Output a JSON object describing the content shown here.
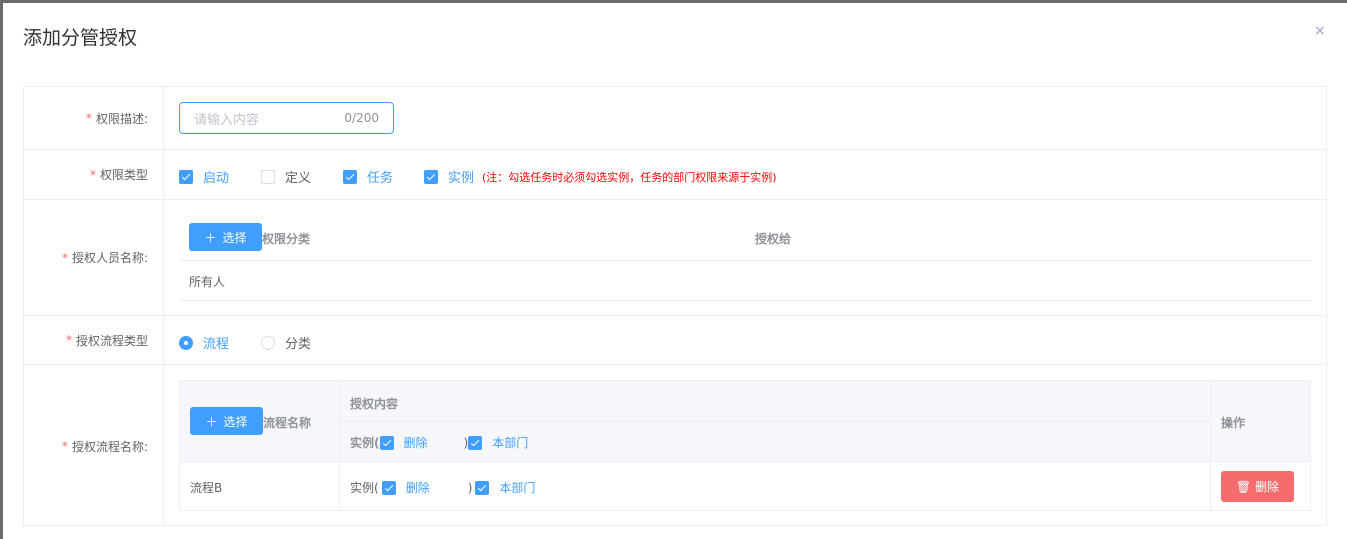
{
  "dialog": {
    "title": "添加分管授权",
    "close": "×"
  },
  "fields": {
    "desc": {
      "label": "权限描述:",
      "placeholder": "请输入内容",
      "counter": "0/200"
    },
    "type": {
      "label": "权限类型",
      "options": [
        {
          "label": "启动",
          "checked": true
        },
        {
          "label": "定义",
          "checked": false
        },
        {
          "label": "任务",
          "checked": true
        },
        {
          "label": "实例",
          "checked": true
        }
      ],
      "note": "(注：勾选任务时必须勾选实例，任务的部门权限来源于实例)"
    },
    "persons": {
      "label": "授权人员名称:",
      "select": "选择",
      "columns": [
        "权限分类",
        "授权给"
      ],
      "rows": [
        {
          "category": "所有人",
          "to": ""
        }
      ]
    },
    "flow_type": {
      "label": "授权流程类型",
      "options": [
        {
          "label": "流程",
          "selected": true
        },
        {
          "label": "分类",
          "selected": false
        }
      ]
    },
    "flows": {
      "label": "授权流程名称:",
      "select": "选择",
      "col_name": "流程名称",
      "col_content": "授权内容",
      "col_action": "操作",
      "instance_prefix": "实例(",
      "close_paren": ")",
      "delete_label": "删除",
      "dept_label": "本部门",
      "rows": [
        {
          "name": "流程B",
          "delete_btn": "删除"
        }
      ]
    }
  },
  "required_mark": "*"
}
